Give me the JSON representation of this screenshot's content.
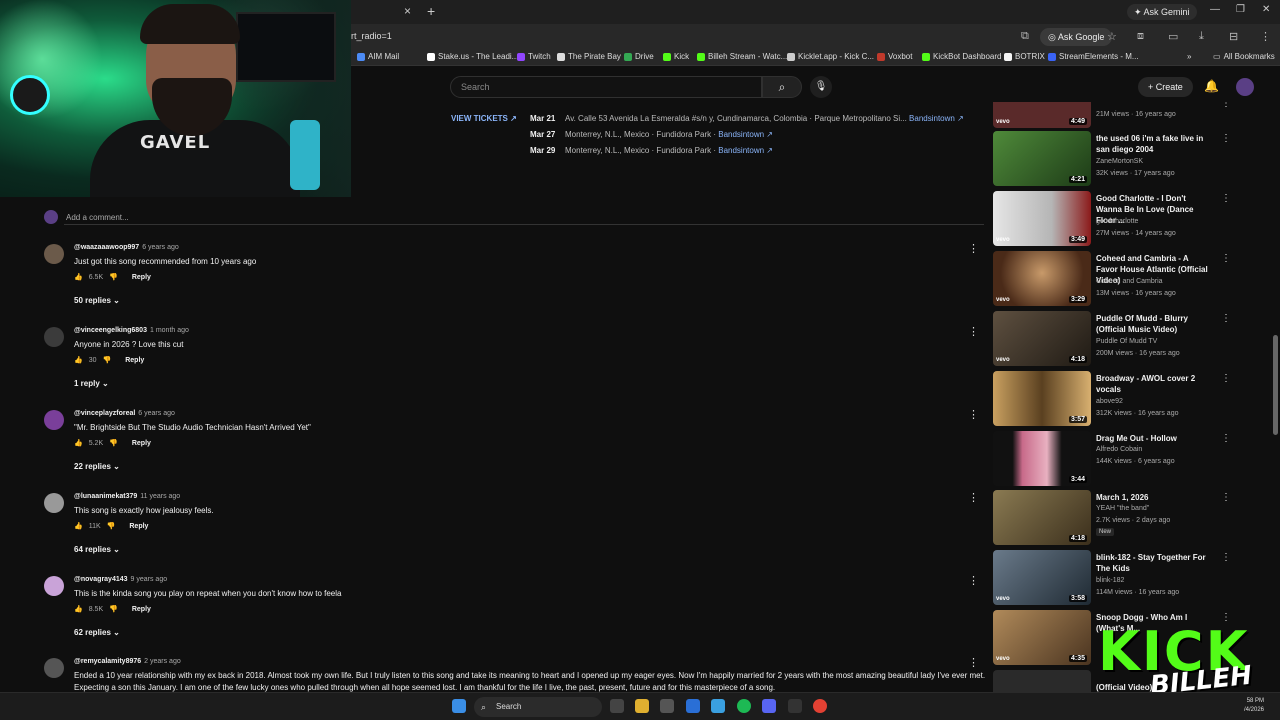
{
  "browser": {
    "tab_close": "×",
    "tab_new": "+",
    "gemini_label": "Ask Gemini",
    "url_fragment": "rt_radio=1",
    "ask_google": "Ask Google",
    "bookmarks": [
      {
        "label": "AIM Mail",
        "color": "#4c8bf5"
      },
      {
        "label": "Stake.us - The Leadi...",
        "color": "#ffffff"
      },
      {
        "label": "Twitch",
        "color": "#9146ff"
      },
      {
        "label": "The Pirate Bay",
        "color": "#dddddd"
      },
      {
        "label": "Drive",
        "color": "#34a853"
      },
      {
        "label": "Kick",
        "color": "#53fc18"
      },
      {
        "label": "Billeh Stream - Watc...",
        "color": "#53fc18"
      },
      {
        "label": "Kicklet.app - Kick C...",
        "color": "#cccccc"
      },
      {
        "label": "Voxbot",
        "color": "#c0392b"
      },
      {
        "label": "KickBot Dashboard",
        "color": "#53fc18"
      },
      {
        "label": "BOTRIX",
        "color": "#f5f5f5"
      },
      {
        "label": "StreamElements - M...",
        "color": "#3a63f5"
      }
    ],
    "all_bookmarks": "All Bookmarks"
  },
  "webcam": {
    "shirt_text": "GAVEL"
  },
  "youtube": {
    "search_placeholder": "Search",
    "create_label": "Create"
  },
  "tour": {
    "view_tickets": "VIEW TICKETS ↗",
    "rows": [
      {
        "date": "Mar 21",
        "venue": "Av. Calle 53 Avenida La Esmeralda #s/n y, Cundinamarca, Colombia · Parque Metropolitano Si...",
        "link": "Bandsintown ↗"
      },
      {
        "date": "Mar 27",
        "venue": "Monterrey, N.L., Mexico · Fundidora Park ·",
        "link": "Bandsintown ↗"
      },
      {
        "date": "Mar 29",
        "venue": "Monterrey, N.L., Mexico · Fundidora Park ·",
        "link": "Bandsintown ↗"
      }
    ]
  },
  "comments_section": {
    "add_placeholder": "Add a comment...",
    "items": [
      {
        "user": "@waazaaawoop997",
        "time": "6 years ago",
        "text": "Just got this song recommended from 10 years ago",
        "likes": "6.5K",
        "reply": "Reply",
        "replies": "50 replies",
        "avatar_color": "#6b5a4a"
      },
      {
        "user": "@vinceengelking6803",
        "time": "1 month ago",
        "text": "Anyone in 2026 ? Love this cut",
        "likes": "30",
        "reply": "Reply",
        "replies": "1 reply",
        "avatar_color": "#3b3b3b"
      },
      {
        "user": "@vinceplayzforeal",
        "time": "6 years ago",
        "text": "\"Mr. Brightside But The Studio Audio Technician Hasn't Arrived Yet\"",
        "likes": "5.2K",
        "reply": "Reply",
        "replies": "22 replies",
        "avatar_color": "#7a3f9a"
      },
      {
        "user": "@lunaanimekat379",
        "time": "11 years ago",
        "text": "This song is exactly how jealousy feels.",
        "likes": "11K",
        "reply": "Reply",
        "replies": "64 replies",
        "avatar_color": "#999999"
      },
      {
        "user": "@novagray4143",
        "time": "9 years ago",
        "text": "This is the kinda song you play on repeat when you don't know how to feela",
        "likes": "8.5K",
        "reply": "Reply",
        "replies": "62 replies",
        "avatar_color": "#c9a3d8"
      },
      {
        "user": "@remycalamity8976",
        "time": "2 years ago",
        "text": "Ended a 10 year relationship with my ex back in 2018. Almost took my own life. But I truly listen to this song and take its meaning to heart and I opened up my eager eyes. Now I'm happily married for 2 years with the most amazing beautiful lady I've ever met. Expecting a son this January. I am one of the few lucky ones who pulled through when all hope seemed lost. I am thankful for the life I live, the past, present, future and for this masterpiece of a song.",
        "avatar_color": "#555555"
      }
    ]
  },
  "related": [
    {
      "title": "",
      "channel": "",
      "meta": "21M views · 16 years ago",
      "duration": "4:49",
      "vevo": true,
      "thumb": "#5a2a2a"
    },
    {
      "title": "the used 06 i'm a fake live in san diego 2004",
      "channel": "ZaneMortonSK",
      "meta": "32K views · 17 years ago",
      "duration": "4:21",
      "vevo": false,
      "thumb": "#3a6b2a"
    },
    {
      "title": "Good Charlotte - I Don't Wanna Be In Love (Dance Floor ...",
      "channel": "goodcharlotte",
      "meta": "27M views · 14 years ago",
      "duration": "3:49",
      "vevo": true,
      "thumb": "#d8d8d8"
    },
    {
      "title": "Coheed and Cambria - A Favor House Atlantic (Official Video)",
      "channel": "Coheed and Cambria",
      "meta": "13M views · 16 years ago",
      "duration": "3:29",
      "vevo": true,
      "thumb": "#6b4a2a"
    },
    {
      "title": "Puddle Of Mudd - Blurry (Official Music Video)",
      "channel": "Puddle Of Mudd TV",
      "meta": "200M views · 16 years ago",
      "duration": "4:18",
      "vevo": true,
      "thumb": "#3d3328"
    },
    {
      "title": "Broadway - AWOL cover 2 vocals",
      "channel": "above92",
      "meta": "312K views · 16 years ago",
      "duration": "3:57",
      "vevo": false,
      "thumb": "#8a6a3a"
    },
    {
      "title": "Drag Me Out - Hollow",
      "channel": "Alfredo Cobain",
      "meta": "144K views · 6 years ago",
      "duration": "3:44",
      "vevo": false,
      "thumb": "#b85a7a"
    },
    {
      "title": "March 1, 2026",
      "channel": "YEAH \"the band\"",
      "meta": "2.7K views · 2 days ago",
      "duration": "4:18",
      "vevo": false,
      "thumb": "#6a5a3a",
      "new": "New"
    },
    {
      "title": "blink-182 - Stay Together For The Kids",
      "channel": "blink-182",
      "meta": "114M views · 16 years ago",
      "duration": "3:58",
      "vevo": true,
      "thumb": "#4a5a6a"
    },
    {
      "title": "Snoop Dogg - Who Am I (What's M...",
      "channel": "",
      "meta": "",
      "duration": "4:35",
      "vevo": true,
      "thumb": "#8a6a4a"
    },
    {
      "title": "(Official Video)",
      "channel": "",
      "meta": "",
      "duration": "",
      "vevo": false,
      "thumb": "#2a2a2a"
    }
  ],
  "kick_overlay": {
    "kick": "KICK",
    "name": "BILLEH"
  },
  "taskbar": {
    "search": "Search",
    "time": "58 PM",
    "date": "/4/2026"
  }
}
